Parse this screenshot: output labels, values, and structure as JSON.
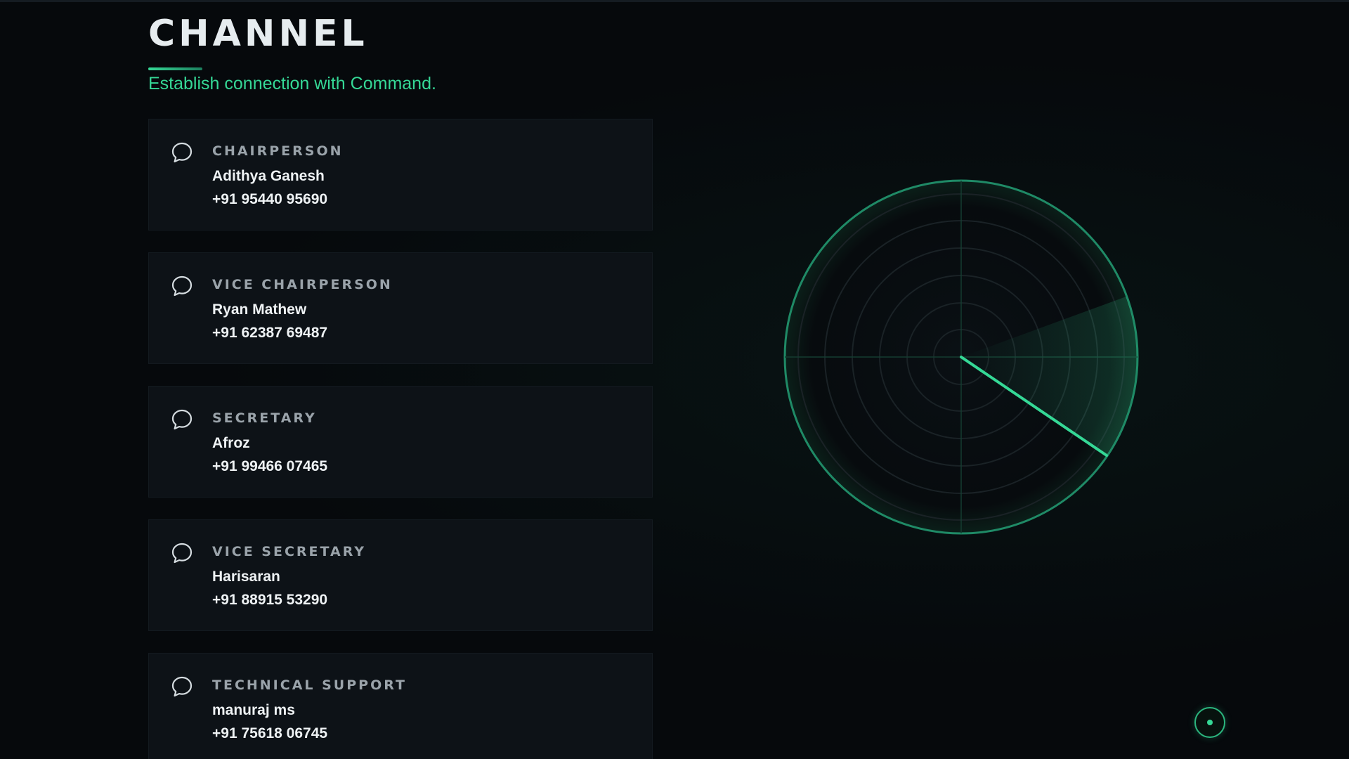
{
  "page": {
    "title": "CHANNEL",
    "subtitle": "Establish connection with Command."
  },
  "contacts": [
    {
      "role": "Chairperson",
      "name": "Adithya Ganesh",
      "phone": "+91 95440 95690",
      "icon": "chat-bubble-icon"
    },
    {
      "role": "Vice Chairperson",
      "name": "Ryan Mathew",
      "phone": "+91 62387 69487",
      "icon": "chat-bubble-icon"
    },
    {
      "role": "Secretary",
      "name": "Afroz",
      "phone": "+91 99466 07465",
      "icon": "chat-bubble-icon"
    },
    {
      "role": "Vice Secretary",
      "name": "Harisaran",
      "phone": "+91 88915 53290",
      "icon": "chat-bubble-icon"
    },
    {
      "role": "Technical Support",
      "name": "manuraj ms",
      "phone": "+91 75618 06745",
      "icon": "chat-bubble-icon"
    }
  ],
  "colors": {
    "accent": "#35d896",
    "background": "#06090c",
    "card": "#0d1217",
    "role_text": "#9aa3aa"
  },
  "radar": {
    "icon": "radar-sweep-icon",
    "sweep_angle_deg": 30
  },
  "status_indicator": {
    "icon": "status-dot-icon"
  }
}
